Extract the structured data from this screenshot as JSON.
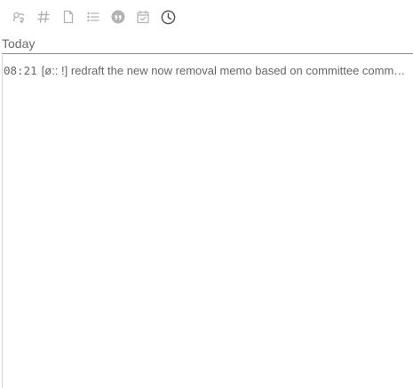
{
  "toolbar": {
    "icons": [
      {
        "name": "tag-filter-icon",
        "state": "inactive"
      },
      {
        "name": "hashtag-icon",
        "state": "inactive"
      },
      {
        "name": "document-icon",
        "state": "inactive"
      },
      {
        "name": "list-icon",
        "state": "inactive"
      },
      {
        "name": "quote-icon",
        "state": "inactive"
      },
      {
        "name": "calendar-check-icon",
        "state": "inactive"
      },
      {
        "name": "clock-icon",
        "state": "active"
      }
    ],
    "colors": {
      "inactive": "#b3b3b3",
      "active": "#555555"
    }
  },
  "section": {
    "title": "Today"
  },
  "entries": [
    {
      "time": "08:21",
      "text": "[ø:: !] redraft the new now removal memo based on committee comments"
    }
  ]
}
